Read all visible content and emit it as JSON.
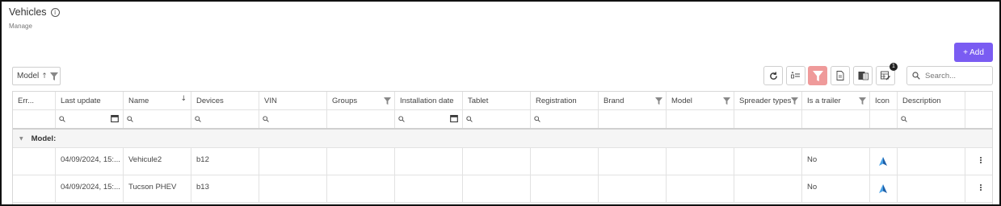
{
  "page": {
    "title": "Vehicles",
    "subtitle": "Manage"
  },
  "toolbar": {
    "add_label": "+ Add",
    "group_chip": "Model",
    "badge_count": "1",
    "search_placeholder": "Search..."
  },
  "colors": {
    "accent": "#7a5cf2",
    "filter_active": "#ef9a9a",
    "vehicle_icon": "#2e86de"
  },
  "grid": {
    "columns": [
      "Err...",
      "Last update",
      "Name",
      "Devices",
      "VIN",
      "Groups",
      "Installation date",
      "Tablet",
      "Registration",
      "Brand",
      "Model",
      "Spreader types",
      "Is a trailer",
      "Icon",
      "Description",
      ""
    ],
    "group_label": "Model:",
    "rows": [
      {
        "last_update": "04/09/2024, 15:...",
        "name": "Vehicule2",
        "devices": "b12",
        "is_trailer": "No"
      },
      {
        "last_update": "04/09/2024, 15:...",
        "name": "Tucson PHEV",
        "devices": "b13",
        "is_trailer": "No"
      }
    ]
  }
}
